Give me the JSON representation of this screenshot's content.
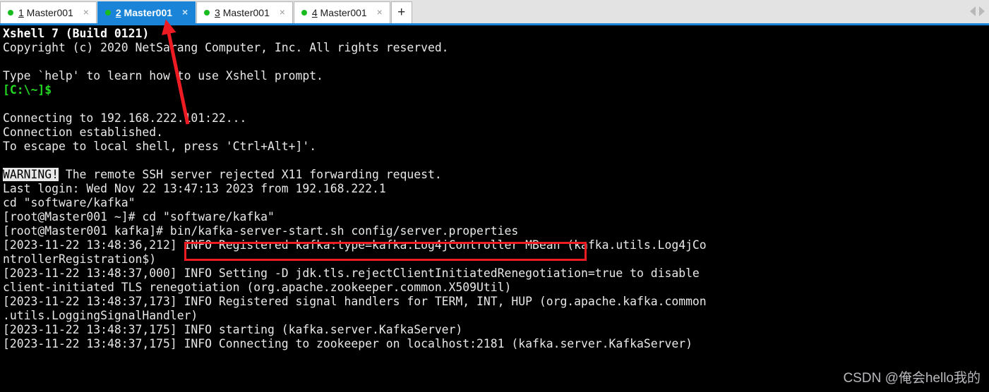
{
  "window": {
    "app_name": "Xshell"
  },
  "tabbar": {
    "new_tab_label": "+",
    "close_icon": "×",
    "scroll_left_name": "scroll-tabs-left",
    "scroll_right_name": "scroll-tabs-right",
    "active_index": 1,
    "tabs": [
      {
        "number": "1",
        "title": " Master001",
        "status": "connected",
        "active": false
      },
      {
        "number": "2",
        "title": " Master001",
        "status": "connected",
        "active": true
      },
      {
        "number": "3",
        "title": " Master001",
        "status": "connected",
        "active": false
      },
      {
        "number": "4",
        "title": " Master001",
        "status": "connected",
        "active": false
      }
    ]
  },
  "colors": {
    "accent_blue": "#1a84d8",
    "tab_dot_green": "#19bb1f",
    "annotation_red": "#ee1c22",
    "terminal_bg": "#000000",
    "terminal_fg": "#e8e8e8",
    "prompt_green": "#23d723"
  },
  "terminal": {
    "lines": [
      {
        "id": "l01",
        "text": "Xshell 7 (Build 0121)",
        "style": "bold"
      },
      {
        "id": "l02",
        "text": "Copyright (c) 2020 NetSarang Computer, Inc. All rights reserved.",
        "style": "normal"
      },
      {
        "id": "l03",
        "text": "",
        "style": "blank"
      },
      {
        "id": "l04",
        "text": "Type `help' to learn how to use Xshell prompt.",
        "style": "normal"
      },
      {
        "id": "l05",
        "text": "[C:\\~]$",
        "style": "prompt-green"
      },
      {
        "id": "l06",
        "text": "",
        "style": "blank"
      },
      {
        "id": "l07",
        "text": "Connecting to 192.168.222.101:22...",
        "style": "normal"
      },
      {
        "id": "l08",
        "text": "Connection established.",
        "style": "normal"
      },
      {
        "id": "l09",
        "text": "To escape to local shell, press 'Ctrl+Alt+]'.",
        "style": "normal"
      },
      {
        "id": "l10",
        "text": "",
        "style": "blank"
      },
      {
        "id": "l11",
        "text": "WARNING!",
        "suffix": " The remote SSH server rejected X11 forwarding request.",
        "style": "inverse-prefix"
      },
      {
        "id": "l12",
        "text": "Last login: Wed Nov 22 13:47:13 2023 from 192.168.222.1",
        "style": "normal"
      },
      {
        "id": "l13",
        "text": "cd \"software/kafka\"",
        "style": "normal"
      },
      {
        "id": "l14",
        "text": "[root@Master001 ~]# cd \"software/kafka\"",
        "style": "normal"
      },
      {
        "id": "l15",
        "text": "[root@Master001 kafka]# bin/kafka-server-start.sh config/server.properties",
        "style": "normal"
      },
      {
        "id": "l16",
        "text": "[2023-11-22 13:48:36,212] INFO Registered kafka:type=kafka.Log4jController MBean (kafka.utils.Log4jCo",
        "style": "normal"
      },
      {
        "id": "l17",
        "text": "ntrollerRegistration$)",
        "style": "normal"
      },
      {
        "id": "l18",
        "text": "[2023-11-22 13:48:37,000] INFO Setting -D jdk.tls.rejectClientInitiatedRenegotiation=true to disable",
        "style": "normal"
      },
      {
        "id": "l19",
        "text": "client-initiated TLS renegotiation (org.apache.zookeeper.common.X509Util)",
        "style": "normal"
      },
      {
        "id": "l20",
        "text": "[2023-11-22 13:48:37,173] INFO Registered signal handlers for TERM, INT, HUP (org.apache.kafka.common",
        "style": "normal"
      },
      {
        "id": "l21",
        "text": ".utils.LoggingSignalHandler)",
        "style": "normal"
      },
      {
        "id": "l22",
        "text": "[2023-11-22 13:48:37,175] INFO starting (kafka.server.KafkaServer)",
        "style": "normal"
      },
      {
        "id": "l23",
        "text": "[2023-11-22 13:48:37,175] INFO Connecting to zookeeper on localhost:2181 (kafka.server.KafkaServer)",
        "style": "normal"
      }
    ]
  },
  "annotations": {
    "highlight_box_target": "bin/kafka-server-start.sh config/server.properties",
    "arrow_target": "Xshell 7 (Build 0121)"
  },
  "watermark": {
    "text": "CSDN @俺会hello我的"
  }
}
